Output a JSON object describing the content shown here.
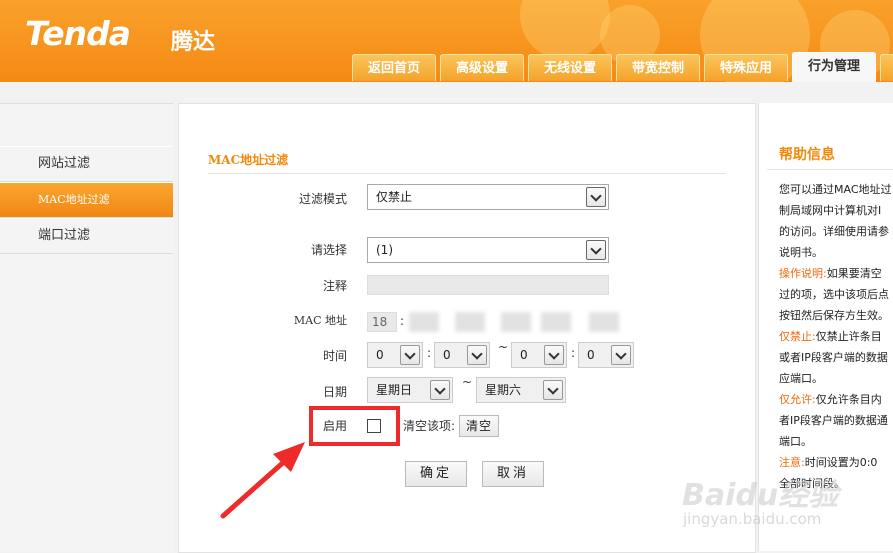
{
  "brand": {
    "logo": "Tenda",
    "logo_cn": "腾达"
  },
  "tabs": [
    {
      "label": "返回首页"
    },
    {
      "label": "高级设置"
    },
    {
      "label": "无线设置"
    },
    {
      "label": "带宽控制"
    },
    {
      "label": "特殊应用"
    },
    {
      "label": "行为管理",
      "active": true
    }
  ],
  "sidebar": {
    "items": [
      {
        "label": "网站过滤"
      },
      {
        "label": "MAC地址过滤",
        "active": true
      },
      {
        "label": "端口过滤"
      }
    ]
  },
  "form": {
    "section_title": "MAC地址过滤",
    "filter_mode_label": "过滤模式",
    "filter_mode_value": "仅禁止",
    "select_label": "请选择",
    "select_value": "(1)",
    "comment_label": "注释",
    "comment_value": "",
    "mac_label": "MAC 地址",
    "mac_first": "18",
    "time_label": "时间",
    "time_start_hour": "0",
    "time_start_min": "0",
    "time_end_hour": "0",
    "time_end_min": "0",
    "date_label": "日期",
    "day_start": "星期日",
    "day_end": "星期六",
    "tilde": "~",
    "colon": ":",
    "enable_label": "启用",
    "enable_checked": false,
    "clear_item_label": "清空该项:",
    "clear_button": "清空",
    "ok_button": "确定",
    "cancel_button": "取消",
    "highlight_color": "#ee2a2a"
  },
  "help": {
    "title": "帮助信息",
    "lines": [
      {
        "pre": "",
        "text": "您可以通过MAC地址过"
      },
      {
        "pre": "",
        "text": "制局域网中计算机对I"
      },
      {
        "pre": "",
        "text": "的访问。详细使用请参"
      },
      {
        "pre": "",
        "text": "说明书。"
      },
      {
        "pre": "操作说明:",
        "text": "如果要清空"
      },
      {
        "pre": "",
        "text": "过的项，选中该项后点"
      },
      {
        "pre": "",
        "text": "按钮然后保存方生效。"
      },
      {
        "pre": "仅禁止:",
        "text": "仅禁止许条目"
      },
      {
        "pre": "",
        "text": "或者IP段客户端的数据"
      },
      {
        "pre": "",
        "text": "应端口。"
      },
      {
        "pre": "仅允许:",
        "text": "仅允许条目内"
      },
      {
        "pre": "",
        "text": "者IP段客户端的数据通"
      },
      {
        "pre": "",
        "text": "端口。"
      },
      {
        "pre": "注意:",
        "text": "时间设置为0:0"
      },
      {
        "pre": "",
        "text": "全部时间段。"
      }
    ]
  },
  "watermark": {
    "text": "Baidu经验",
    "sub": "jingyan.baidu.com"
  },
  "colors": {
    "brand_orange": "#f58a15",
    "accent_text": "#f08a0c"
  }
}
